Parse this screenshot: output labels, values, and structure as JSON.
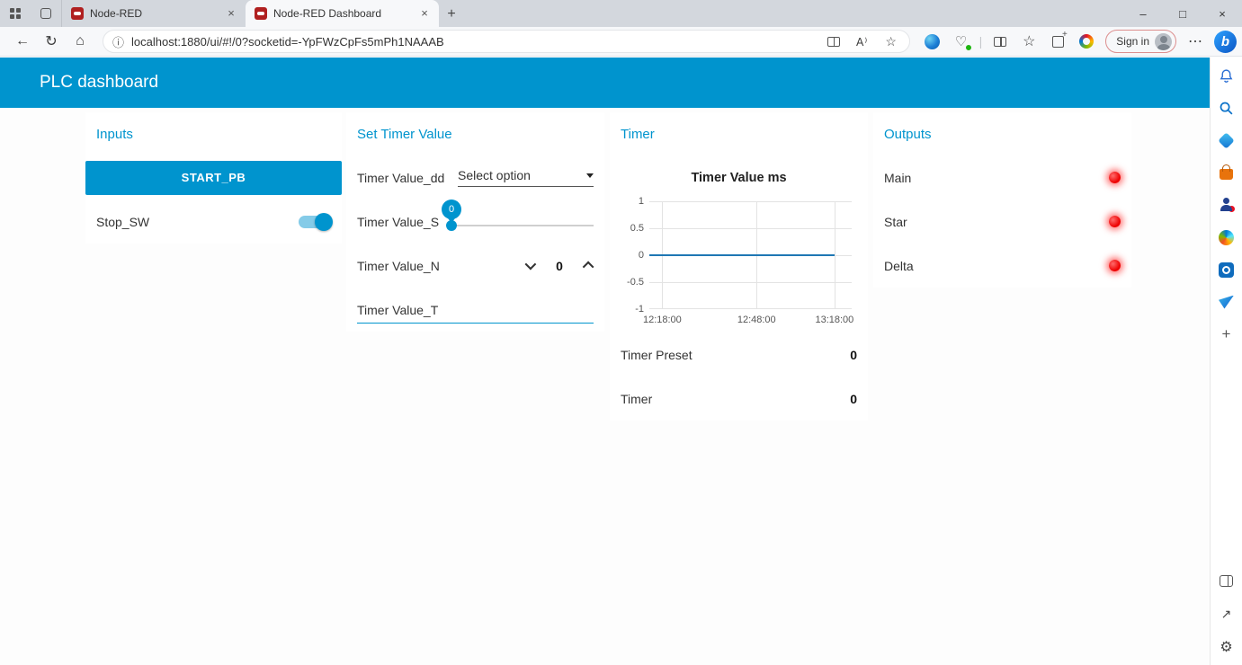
{
  "browser": {
    "tabs": [
      {
        "title": "Node-RED"
      },
      {
        "title": "Node-RED Dashboard"
      }
    ],
    "url": "localhost:1880/ui/#!/0?socketid=-YpFWzCpFs5mPh1NAAAB",
    "sign_in_label": "Sign in"
  },
  "icons": {
    "back": "←",
    "refresh": "↻",
    "home": "⌂",
    "info": "ⓘ",
    "star": "☆",
    "read_aloud": "A⁾",
    "more": "⋯",
    "minimize": "–",
    "maximize": "□",
    "close": "×",
    "new_tab": "+",
    "add": "+",
    "external_link": "↗",
    "settings_gear": "⚙",
    "heart": "♡",
    "bing_b": "b",
    "divider": "|"
  },
  "dashboard": {
    "title": "PLC dashboard",
    "groups": {
      "inputs": {
        "title": "Inputs",
        "button_label": "START_PB",
        "switch_label": "Stop_SW",
        "switch_state": "on"
      },
      "set_timer": {
        "title": "Set Timer Value",
        "dropdown_label": "Timer Value_dd",
        "dropdown_value": "Select option",
        "slider_label": "Timer Value_S",
        "slider_value": "0",
        "numeric_label": "Timer Value_N",
        "numeric_value": "0",
        "text_label": "Timer Value_T"
      },
      "timer": {
        "title": "Timer",
        "preset_label": "Timer Preset",
        "preset_value": "0",
        "timer_label": "Timer",
        "timer_value": "0"
      },
      "outputs": {
        "title": "Outputs",
        "leds": [
          {
            "label": "Main",
            "state": "on"
          },
          {
            "label": "Star",
            "state": "on"
          },
          {
            "label": "Delta",
            "state": "on"
          }
        ]
      }
    }
  },
  "chart_data": {
    "type": "line",
    "title": "Timer Value ms",
    "xlabel": "",
    "ylabel": "",
    "ylim": [
      -1,
      1
    ],
    "grid": true,
    "legend": "none",
    "x_tick_labels": [
      "12:18:00",
      "12:48:00",
      "13:18:00"
    ],
    "y_tick_labels": [
      "1",
      "0.5",
      "0",
      "-0.5",
      "-1"
    ],
    "y_ticks": [
      1,
      0.5,
      0,
      -0.5,
      -1
    ],
    "series": [
      {
        "name": "Timer Value ms",
        "color": "#1f77b4",
        "points": [
          {
            "t": "12:18:00",
            "y": 0
          },
          {
            "t": "13:13:00",
            "y": 0
          }
        ]
      }
    ]
  },
  "colors": {
    "accent": "#0094ce",
    "header_bg": "#0094ce",
    "led_red": "#ff0000",
    "chart_line": "#1f77b4"
  }
}
